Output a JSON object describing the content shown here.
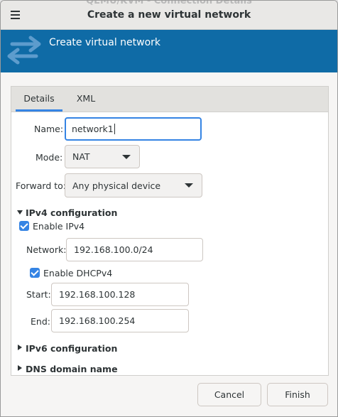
{
  "window": {
    "background_title": "QEMU/KVM - Connection Details",
    "title": "Create a new virtual network",
    "menu_icon": "hamburger-menu-icon"
  },
  "banner": {
    "title": "Create virtual network",
    "icon": "network-arrows-icon",
    "color": "#0f6ba6"
  },
  "tabs": [
    {
      "label": "Details",
      "active": true
    },
    {
      "label": "XML",
      "active": false
    }
  ],
  "form": {
    "name_label": "Name:",
    "name_value": "network1",
    "mode_label": "Mode:",
    "mode_value": "NAT",
    "forward_label": "Forward to:",
    "forward_value": "Any physical device"
  },
  "ipv4": {
    "section_label": "IPv4 configuration",
    "enable_label": "Enable IPv4",
    "enable_checked": true,
    "network_label": "Network:",
    "network_value": "192.168.100.0/24",
    "dhcp_label": "Enable DHCPv4",
    "dhcp_checked": true,
    "start_label": "Start:",
    "start_value": "192.168.100.128",
    "end_label": "End:",
    "end_value": "192.168.100.254"
  },
  "sections": {
    "ipv6_label": "IPv6 configuration",
    "dns_label": "DNS domain name"
  },
  "buttons": {
    "cancel": "Cancel",
    "finish": "Finish"
  },
  "colors": {
    "accent": "#3584e4",
    "banner": "#0f6ba6"
  }
}
